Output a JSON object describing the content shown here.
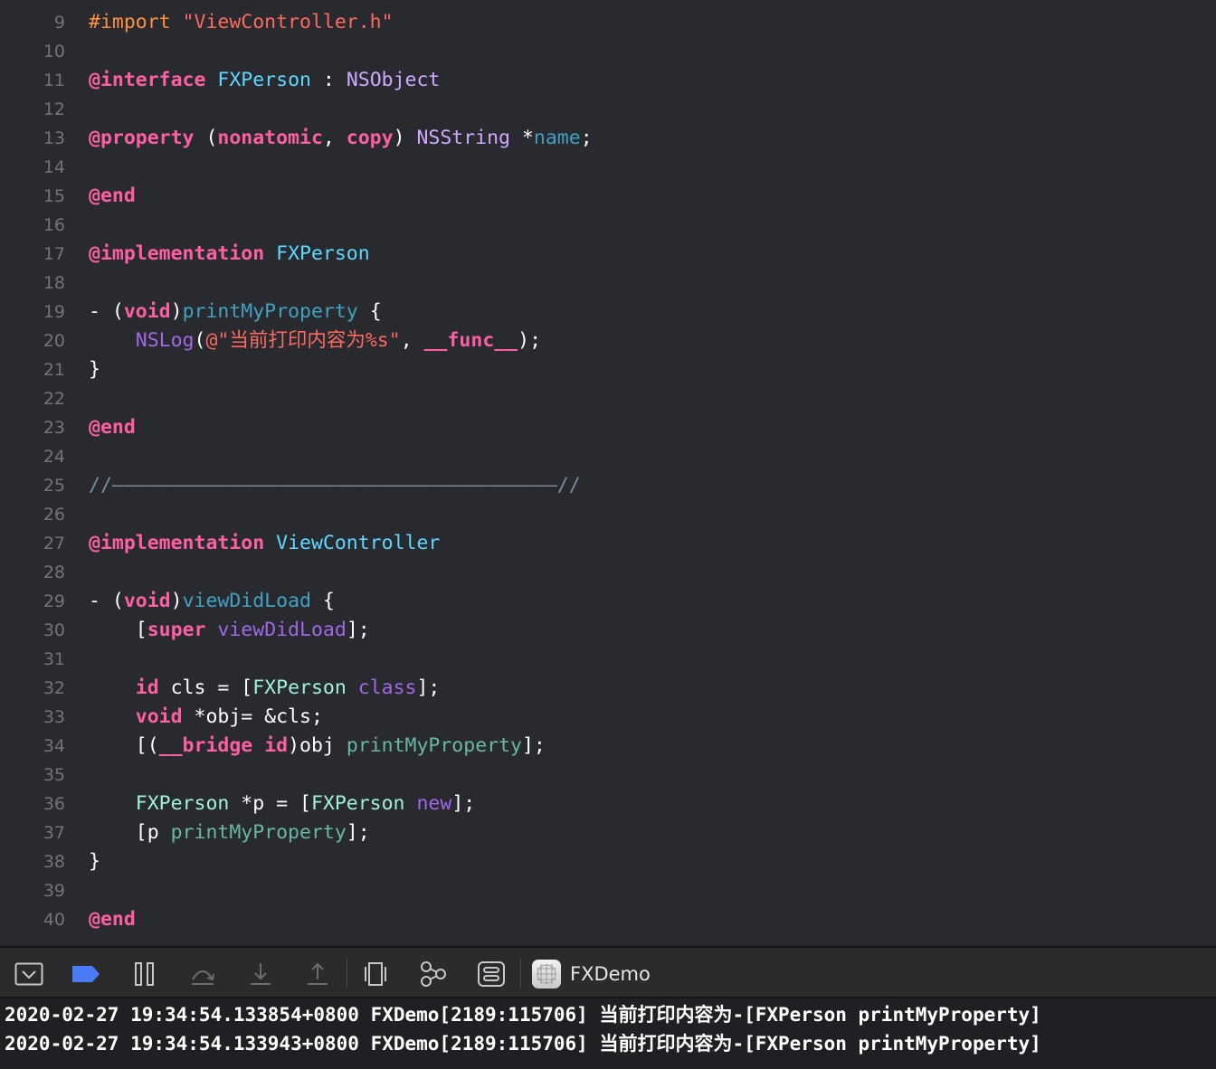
{
  "editor": {
    "lines": [
      {
        "num": "9",
        "tokens": [
          {
            "t": "#import ",
            "c": "t-pp"
          },
          {
            "t": "\"ViewController.h\"",
            "c": "t-str"
          }
        ]
      },
      {
        "num": "10",
        "tokens": []
      },
      {
        "num": "11",
        "tokens": [
          {
            "t": "@interface",
            "c": "t-kw"
          },
          {
            "t": " ",
            "c": "t-pl"
          },
          {
            "t": "FXPerson",
            "c": "t-cls"
          },
          {
            "t": " : ",
            "c": "t-pl"
          },
          {
            "t": "NSObject",
            "c": "t-sys"
          }
        ]
      },
      {
        "num": "12",
        "tokens": []
      },
      {
        "num": "13",
        "tokens": [
          {
            "t": "@property",
            "c": "t-kw"
          },
          {
            "t": " (",
            "c": "t-pl"
          },
          {
            "t": "nonatomic",
            "c": "t-kw"
          },
          {
            "t": ", ",
            "c": "t-pl"
          },
          {
            "t": "copy",
            "c": "t-kw"
          },
          {
            "t": ") ",
            "c": "t-pl"
          },
          {
            "t": "NSString",
            "c": "t-sys"
          },
          {
            "t": " *",
            "c": "t-pl"
          },
          {
            "t": "name",
            "c": "t-var"
          },
          {
            "t": ";",
            "c": "t-pl"
          }
        ]
      },
      {
        "num": "14",
        "tokens": []
      },
      {
        "num": "15",
        "tokens": [
          {
            "t": "@end",
            "c": "t-kw"
          }
        ]
      },
      {
        "num": "16",
        "tokens": []
      },
      {
        "num": "17",
        "tokens": [
          {
            "t": "@implementation",
            "c": "t-kw"
          },
          {
            "t": " ",
            "c": "t-pl"
          },
          {
            "t": "FXPerson",
            "c": "t-cls"
          }
        ]
      },
      {
        "num": "18",
        "tokens": []
      },
      {
        "num": "19",
        "tokens": [
          {
            "t": "- (",
            "c": "t-pl"
          },
          {
            "t": "void",
            "c": "t-kw"
          },
          {
            "t": ")",
            "c": "t-pl"
          },
          {
            "t": "printMyProperty",
            "c": "t-var"
          },
          {
            "t": " {",
            "c": "t-pl"
          }
        ]
      },
      {
        "num": "20",
        "tokens": [
          {
            "t": "    ",
            "c": "t-pl"
          },
          {
            "t": "NSLog",
            "c": "t-sysf"
          },
          {
            "t": "(",
            "c": "t-pl"
          },
          {
            "t": "@\"当前打印内容为%s\"",
            "c": "t-str"
          },
          {
            "t": ", ",
            "c": "t-pl"
          },
          {
            "t": "__func__",
            "c": "t-kw"
          },
          {
            "t": ");",
            "c": "t-pl"
          }
        ]
      },
      {
        "num": "21",
        "tokens": [
          {
            "t": "}",
            "c": "t-pl"
          }
        ]
      },
      {
        "num": "22",
        "tokens": []
      },
      {
        "num": "23",
        "tokens": [
          {
            "t": "@end",
            "c": "t-kw"
          }
        ]
      },
      {
        "num": "24",
        "tokens": []
      },
      {
        "num": "25",
        "tokens": [
          {
            "t": "//——————————————————————————————————————//",
            "c": "t-cm"
          }
        ]
      },
      {
        "num": "26",
        "tokens": []
      },
      {
        "num": "27",
        "tokens": [
          {
            "t": "@implementation",
            "c": "t-kw"
          },
          {
            "t": " ",
            "c": "t-pl"
          },
          {
            "t": "ViewController",
            "c": "t-cls"
          }
        ]
      },
      {
        "num": "28",
        "tokens": []
      },
      {
        "num": "29",
        "tokens": [
          {
            "t": "- (",
            "c": "t-pl"
          },
          {
            "t": "void",
            "c": "t-kw"
          },
          {
            "t": ")",
            "c": "t-pl"
          },
          {
            "t": "viewDidLoad",
            "c": "t-var"
          },
          {
            "t": " {",
            "c": "t-pl"
          }
        ]
      },
      {
        "num": "30",
        "tokens": [
          {
            "t": "    [",
            "c": "t-pl"
          },
          {
            "t": "super",
            "c": "t-kw"
          },
          {
            "t": " ",
            "c": "t-pl"
          },
          {
            "t": "viewDidLoad",
            "c": "t-sysf"
          },
          {
            "t": "];",
            "c": "t-pl"
          }
        ]
      },
      {
        "num": "31",
        "tokens": []
      },
      {
        "num": "32",
        "tokens": [
          {
            "t": "    ",
            "c": "t-pl"
          },
          {
            "t": "id",
            "c": "t-kw"
          },
          {
            "t": " cls = [",
            "c": "t-pl"
          },
          {
            "t": "FXPerson",
            "c": "t-proj"
          },
          {
            "t": " ",
            "c": "t-pl"
          },
          {
            "t": "class",
            "c": "t-sysf"
          },
          {
            "t": "];",
            "c": "t-pl"
          }
        ]
      },
      {
        "num": "33",
        "tokens": [
          {
            "t": "    ",
            "c": "t-pl"
          },
          {
            "t": "void",
            "c": "t-kw"
          },
          {
            "t": " *obj= &cls;",
            "c": "t-pl"
          }
        ]
      },
      {
        "num": "34",
        "tokens": [
          {
            "t": "    [(",
            "c": "t-pl"
          },
          {
            "t": "__bridge",
            "c": "t-kw"
          },
          {
            "t": " ",
            "c": "t-pl"
          },
          {
            "t": "id",
            "c": "t-kw"
          },
          {
            "t": ")obj ",
            "c": "t-pl"
          },
          {
            "t": "printMyProperty",
            "c": "t-projf"
          },
          {
            "t": "];",
            "c": "t-pl"
          }
        ]
      },
      {
        "num": "35",
        "tokens": []
      },
      {
        "num": "36",
        "tokens": [
          {
            "t": "    ",
            "c": "t-pl"
          },
          {
            "t": "FXPerson",
            "c": "t-proj"
          },
          {
            "t": " *p = [",
            "c": "t-pl"
          },
          {
            "t": "FXPerson",
            "c": "t-proj"
          },
          {
            "t": " ",
            "c": "t-pl"
          },
          {
            "t": "new",
            "c": "t-sysf"
          },
          {
            "t": "];",
            "c": "t-pl"
          }
        ]
      },
      {
        "num": "37",
        "tokens": [
          {
            "t": "    [p ",
            "c": "t-pl"
          },
          {
            "t": "printMyProperty",
            "c": "t-projf"
          },
          {
            "t": "];",
            "c": "t-pl"
          }
        ]
      },
      {
        "num": "38",
        "tokens": [
          {
            "t": "}",
            "c": "t-pl"
          }
        ]
      },
      {
        "num": "39",
        "tokens": []
      },
      {
        "num": "40",
        "tokens": [
          {
            "t": "@end",
            "c": "t-kw"
          }
        ]
      }
    ]
  },
  "toolbar": {
    "buttons": [
      {
        "name": "hide-debug-area-icon"
      },
      {
        "name": "breakpoints-toggle-icon"
      },
      {
        "name": "pause-icon"
      },
      {
        "name": "step-over-icon"
      },
      {
        "name": "step-into-icon"
      },
      {
        "name": "step-out-icon"
      },
      {
        "name": "view-hierarchy-icon"
      },
      {
        "name": "memory-graph-icon"
      },
      {
        "name": "environment-overrides-icon"
      }
    ],
    "scheme_label": "FXDemo"
  },
  "console": {
    "lines": [
      "2020-02-27 19:34:54.133854+0800 FXDemo[2189:115706] 当前打印内容为-[FXPerson printMyProperty]",
      "2020-02-27 19:34:54.133943+0800 FXDemo[2189:115706] 当前打印内容为-[FXPerson printMyProperty]"
    ]
  },
  "colors": {
    "keyword": "#fc5fa3",
    "preprocessor": "#fd8f3f",
    "string": "#fc6a5d",
    "type_declaration": "#5dd8ff",
    "system_type": "#d0a8ff",
    "system_function": "#a167e6",
    "project_type": "#9ef1dd",
    "project_function": "#67b7a4",
    "declaration": "#41a1c0",
    "comment": "#7f8c98",
    "breakpoint_accent": "#4c7cf5"
  }
}
